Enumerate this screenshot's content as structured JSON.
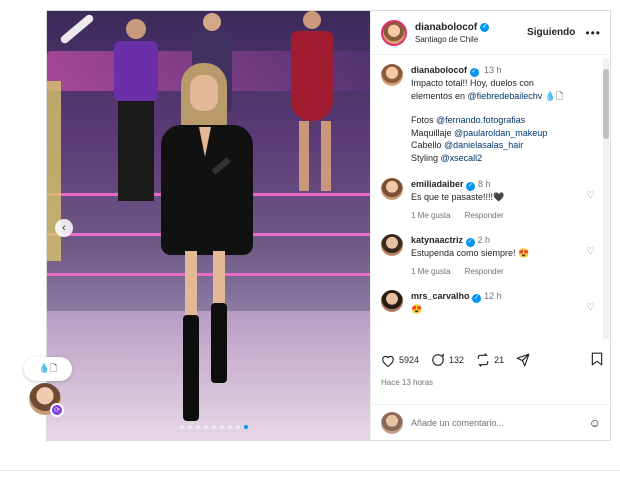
{
  "post": {
    "author": "dianabolocof",
    "location": "Santiago de Chile",
    "follow_label": "Siguiendo",
    "more_label": "•••"
  },
  "caption": {
    "username": "dianabolocof",
    "time": "13 h",
    "line1": "Impacto total!! Hoy, duelos con",
    "line2_text": "elementos en ",
    "line2_link": "@fiebredebailechv",
    "line2_suffix": " 💧🗋",
    "fotos_label": "Fotos ",
    "fotos_link": "@fernando.fotografias",
    "maquillaje_label": "Maquillaje ",
    "maquillaje_link": "@paularoldan_makeup",
    "cabello_label": "Cabello ",
    "cabello_link": "@danielasalas_hair",
    "styling_label": "Styling ",
    "styling_link": "@xsecall2"
  },
  "comments": [
    {
      "username": "emiliadaiber",
      "time": "8 h",
      "text": "Es que te pasaste!!!!🖤",
      "likes": "1 Me gusta",
      "reply": "Responder"
    },
    {
      "username": "katynaactriz",
      "time": "2 h",
      "text": "Estupenda como siempre! 😍",
      "likes": "1 Me gusta",
      "reply": "Responder"
    },
    {
      "username": "mrs_carvalho",
      "time": "12 h",
      "text": "😍",
      "likes": "",
      "reply": ""
    }
  ],
  "actions": {
    "likes": "5924",
    "comments": "132",
    "shares": "21"
  },
  "time_ago": "Hace 13 horas",
  "add_comment_placeholder": "Añade un comentario...",
  "float_pill_text": "💧🗋",
  "colors": {
    "accent": "#0095f6",
    "link": "#00376b",
    "story_ring": "#e1306c",
    "muted": "#737373"
  },
  "icons": [
    "verified-icon",
    "heart-icon",
    "comment-icon",
    "share-icon",
    "send-icon",
    "save-icon",
    "emoji-icon",
    "chevron-left-icon"
  ]
}
